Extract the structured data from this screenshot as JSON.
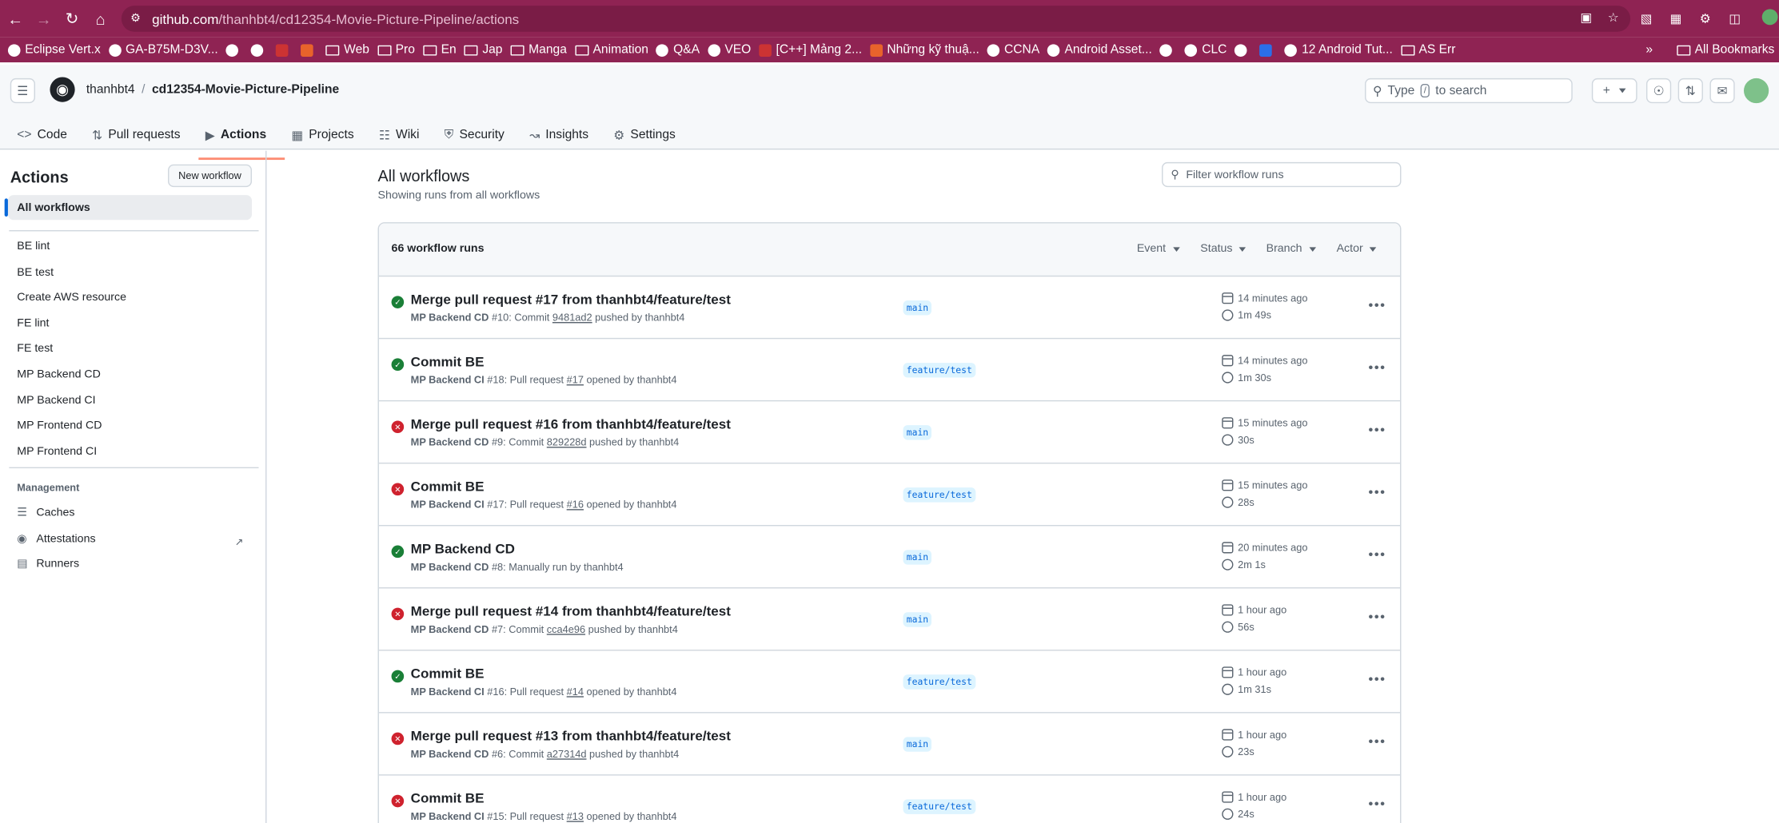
{
  "browser": {
    "url_host": "github.com",
    "url_path": "/thanhbt4/cd12354-Movie-Picture-Pipeline/actions",
    "bookmarks": [
      "Eclipse Vert.x",
      "GA-B75M-D3V...",
      "",
      "",
      "",
      "",
      "Web",
      "Pro",
      "En",
      "Jap",
      "Manga",
      "Animation",
      "Q&A",
      "VEO",
      "[C++] Mảng 2...",
      "Những kỹ thuậ...",
      "CCNA",
      "Android Asset...",
      "",
      "CLC",
      "",
      "",
      "12 Android Tut...",
      "AS Err"
    ],
    "all_bookmarks": "All Bookmarks"
  },
  "header": {
    "owner": "thanhbt4",
    "separator": "/",
    "repo": "cd12354-Movie-Picture-Pipeline",
    "search_prefix": "Type",
    "search_key": "/",
    "search_suffix": "to search"
  },
  "tabs": [
    {
      "label": "Code",
      "icon": "code-icon"
    },
    {
      "label": "Pull requests",
      "icon": "pull-request-icon"
    },
    {
      "label": "Actions",
      "icon": "play-icon"
    },
    {
      "label": "Projects",
      "icon": "table-icon"
    },
    {
      "label": "Wiki",
      "icon": "book-icon"
    },
    {
      "label": "Security",
      "icon": "shield-icon"
    },
    {
      "label": "Insights",
      "icon": "graph-icon"
    },
    {
      "label": "Settings",
      "icon": "gear-icon"
    }
  ],
  "sidebar": {
    "title": "Actions",
    "new_workflow": "New workflow",
    "all_workflows": "All workflows",
    "workflows": [
      "BE lint",
      "BE test",
      "Create AWS resource",
      "FE lint",
      "FE test",
      "MP Backend CD",
      "MP Backend CI",
      "MP Frontend CD",
      "MP Frontend CI"
    ],
    "management_title": "Management",
    "management": [
      "Caches",
      "Attestations",
      "Runners"
    ]
  },
  "main": {
    "title": "All workflows",
    "subtitle": "Showing runs from all workflows",
    "filter_placeholder": "Filter workflow runs",
    "count": "66 workflow runs",
    "filters": [
      "Event",
      "Status",
      "Branch",
      "Actor"
    ],
    "runs": [
      {
        "status": "success",
        "title": "Merge pull request #17 from thanhbt4/feature/test",
        "wf": "MP Backend CD",
        "meta_a": " #10: Commit ",
        "link": "9481ad2",
        "meta_b": " pushed by thanhbt4",
        "branch": "main",
        "time": "14 minutes ago",
        "duration": "1m 49s"
      },
      {
        "status": "success",
        "title": "Commit BE",
        "wf": "MP Backend CI",
        "meta_a": " #18: Pull request ",
        "link": "#17",
        "meta_b": " opened by thanhbt4",
        "branch": "feature/test",
        "time": "14 minutes ago",
        "duration": "1m 30s"
      },
      {
        "status": "failure",
        "title": "Merge pull request #16 from thanhbt4/feature/test",
        "wf": "MP Backend CD",
        "meta_a": " #9: Commit ",
        "link": "829228d",
        "meta_b": " pushed by thanhbt4",
        "branch": "main",
        "time": "15 minutes ago",
        "duration": "30s"
      },
      {
        "status": "failure",
        "title": "Commit BE",
        "wf": "MP Backend CI",
        "meta_a": " #17: Pull request ",
        "link": "#16",
        "meta_b": " opened by thanhbt4",
        "branch": "feature/test",
        "time": "15 minutes ago",
        "duration": "28s"
      },
      {
        "status": "success",
        "title": "MP Backend CD",
        "wf": "MP Backend CD",
        "meta_a": " #8: Manually run by thanhbt4",
        "link": "",
        "meta_b": "",
        "branch": "main",
        "time": "20 minutes ago",
        "duration": "2m 1s"
      },
      {
        "status": "failure",
        "title": "Merge pull request #14 from thanhbt4/feature/test",
        "wf": "MP Backend CD",
        "meta_a": " #7: Commit ",
        "link": "cca4e96",
        "meta_b": " pushed by thanhbt4",
        "branch": "main",
        "time": "1 hour ago",
        "duration": "56s"
      },
      {
        "status": "success",
        "title": "Commit BE",
        "wf": "MP Backend CI",
        "meta_a": " #16: Pull request ",
        "link": "#14",
        "meta_b": " opened by thanhbt4",
        "branch": "feature/test",
        "time": "1 hour ago",
        "duration": "1m 31s"
      },
      {
        "status": "failure",
        "title": "Merge pull request #13 from thanhbt4/feature/test",
        "wf": "MP Backend CD",
        "meta_a": " #6: Commit ",
        "link": "a27314d",
        "meta_b": " pushed by thanhbt4",
        "branch": "main",
        "time": "1 hour ago",
        "duration": "23s"
      },
      {
        "status": "failure",
        "title": "Commit BE",
        "wf": "MP Backend CI",
        "meta_a": " #15: Pull request ",
        "link": "#13",
        "meta_b": " opened by thanhbt4",
        "branch": "feature/test",
        "time": "1 hour ago",
        "duration": "24s"
      }
    ]
  },
  "colors": {
    "browser": "#8f2353",
    "success": "#1a7f37",
    "failure": "#cf222e",
    "accent": "#fd8c73",
    "link": "#0969da"
  }
}
